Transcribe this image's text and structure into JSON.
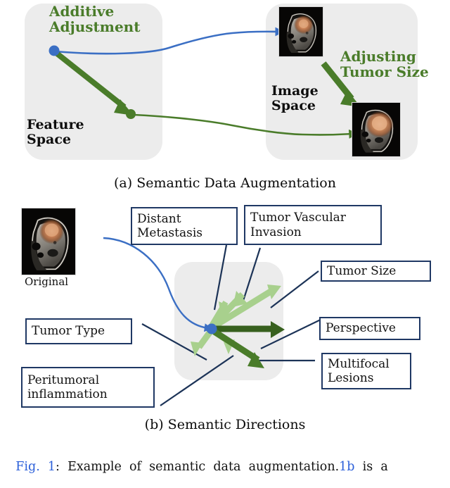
{
  "figure": {
    "panel_a": {
      "caption": "(a) Semantic Data Augmentation",
      "feature_space_box": {
        "label": "Feature\nSpace",
        "annotation": "Additive\nAdjustment"
      },
      "image_space_box": {
        "label": "Image\nSpace",
        "annotation": "Adjusting\nTumor Size"
      },
      "mri_top_alt": "brain MRI sagittal with small orange tumor",
      "mri_bottom_alt": "brain MRI sagittal with enlarged orange tumor"
    },
    "panel_b": {
      "caption": "(b) Semantic Directions",
      "original_label": "Original",
      "mri_alt": "original brain MRI sagittal with orange tumor",
      "direction_labels": [
        "Distant\nMetastasis",
        "Tumor Vascular\nInvasion",
        "Tumor Size",
        "Perspective",
        "Multifocal\nLesions",
        "Peritumoral\ninflammation",
        "Tumor Type"
      ]
    },
    "main_caption": {
      "prefix": "Fig.  1",
      "separator": ":  ",
      "body_1": "Example  of  semantic  data  augmentation.",
      "link_1": "1b",
      "body_2": "  is  a"
    },
    "colors": {
      "light_green": "#a8d08d",
      "dark_green": "#4a7c2a",
      "darker_green": "#37601e",
      "blue": "#3b6fc4",
      "navy": "#1f3864",
      "panel_gray": "#ececec",
      "link_blue": "#2b5fd9"
    }
  }
}
